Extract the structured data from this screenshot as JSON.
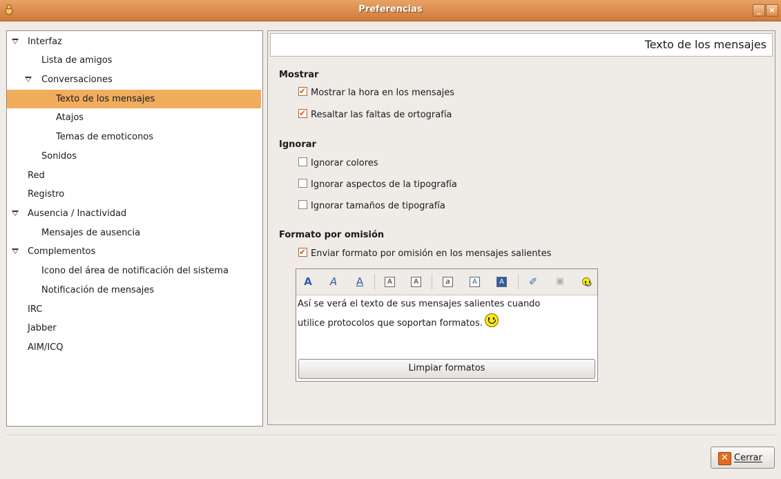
{
  "window": {
    "title": "Preferencias"
  },
  "tree": [
    {
      "label": "Interfaz",
      "expandable": true,
      "selected": false
    },
    {
      "label": "Lista de amigos",
      "expandable": false,
      "selected": false
    },
    {
      "label": "Conversaciones",
      "expandable": true,
      "selected": false
    },
    {
      "label": "Texto de los mensajes",
      "expandable": false,
      "selected": true
    },
    {
      "label": "Atajos",
      "expandable": false,
      "selected": false
    },
    {
      "label": "Temas de emoticonos",
      "expandable": false,
      "selected": false
    },
    {
      "label": "Sonidos",
      "expandable": false,
      "selected": false
    },
    {
      "label": "Red",
      "expandable": false,
      "selected": false
    },
    {
      "label": "Registro",
      "expandable": false,
      "selected": false
    },
    {
      "label": "Ausencia / Inactividad",
      "expandable": true,
      "selected": false
    },
    {
      "label": "Mensajes de ausencia",
      "expandable": false,
      "selected": false
    },
    {
      "label": "Complementos",
      "expandable": true,
      "selected": false
    },
    {
      "label": "Icono del área de notificación del sistema",
      "expandable": false,
      "selected": false
    },
    {
      "label": "Notificación de mensajes",
      "expandable": false,
      "selected": false
    },
    {
      "label": "IRC",
      "expandable": false,
      "selected": false
    },
    {
      "label": "Jabber",
      "expandable": false,
      "selected": false
    },
    {
      "label": "AIM/ICQ",
      "expandable": false,
      "selected": false
    }
  ],
  "panel": {
    "title": "Texto de los mensajes",
    "show": {
      "heading": "Mostrar",
      "options": [
        {
          "label": "Mostrar la hora en los mensajes",
          "checked": true
        },
        {
          "label": "Resaltar las faltas de ortografía",
          "checked": true
        }
      ]
    },
    "ignore": {
      "heading": "Ignorar",
      "options": [
        {
          "label": "Ignorar colores",
          "checked": false
        },
        {
          "label": "Ignorar aspectos de la tipografía",
          "checked": false
        },
        {
          "label": "Ignorar tamaños de tipografía",
          "checked": false
        }
      ]
    },
    "default_format": {
      "heading": "Formato por omisión",
      "send_option": {
        "label": "Enviar formato por omisión en los mensajes salientes",
        "checked": true
      },
      "preview_line1": "Así se verá el texto de sus mensajes salientes cuando",
      "preview_line2": "utilice protocolos que soportan formatos.",
      "clear_label": "Limpiar formatos"
    }
  },
  "footer": {
    "close_label": "Cerrar"
  },
  "colors": {
    "selection": "#f1ac5e",
    "titlebar": "#d9864a",
    "checkbox_accent": "#d35d14"
  }
}
